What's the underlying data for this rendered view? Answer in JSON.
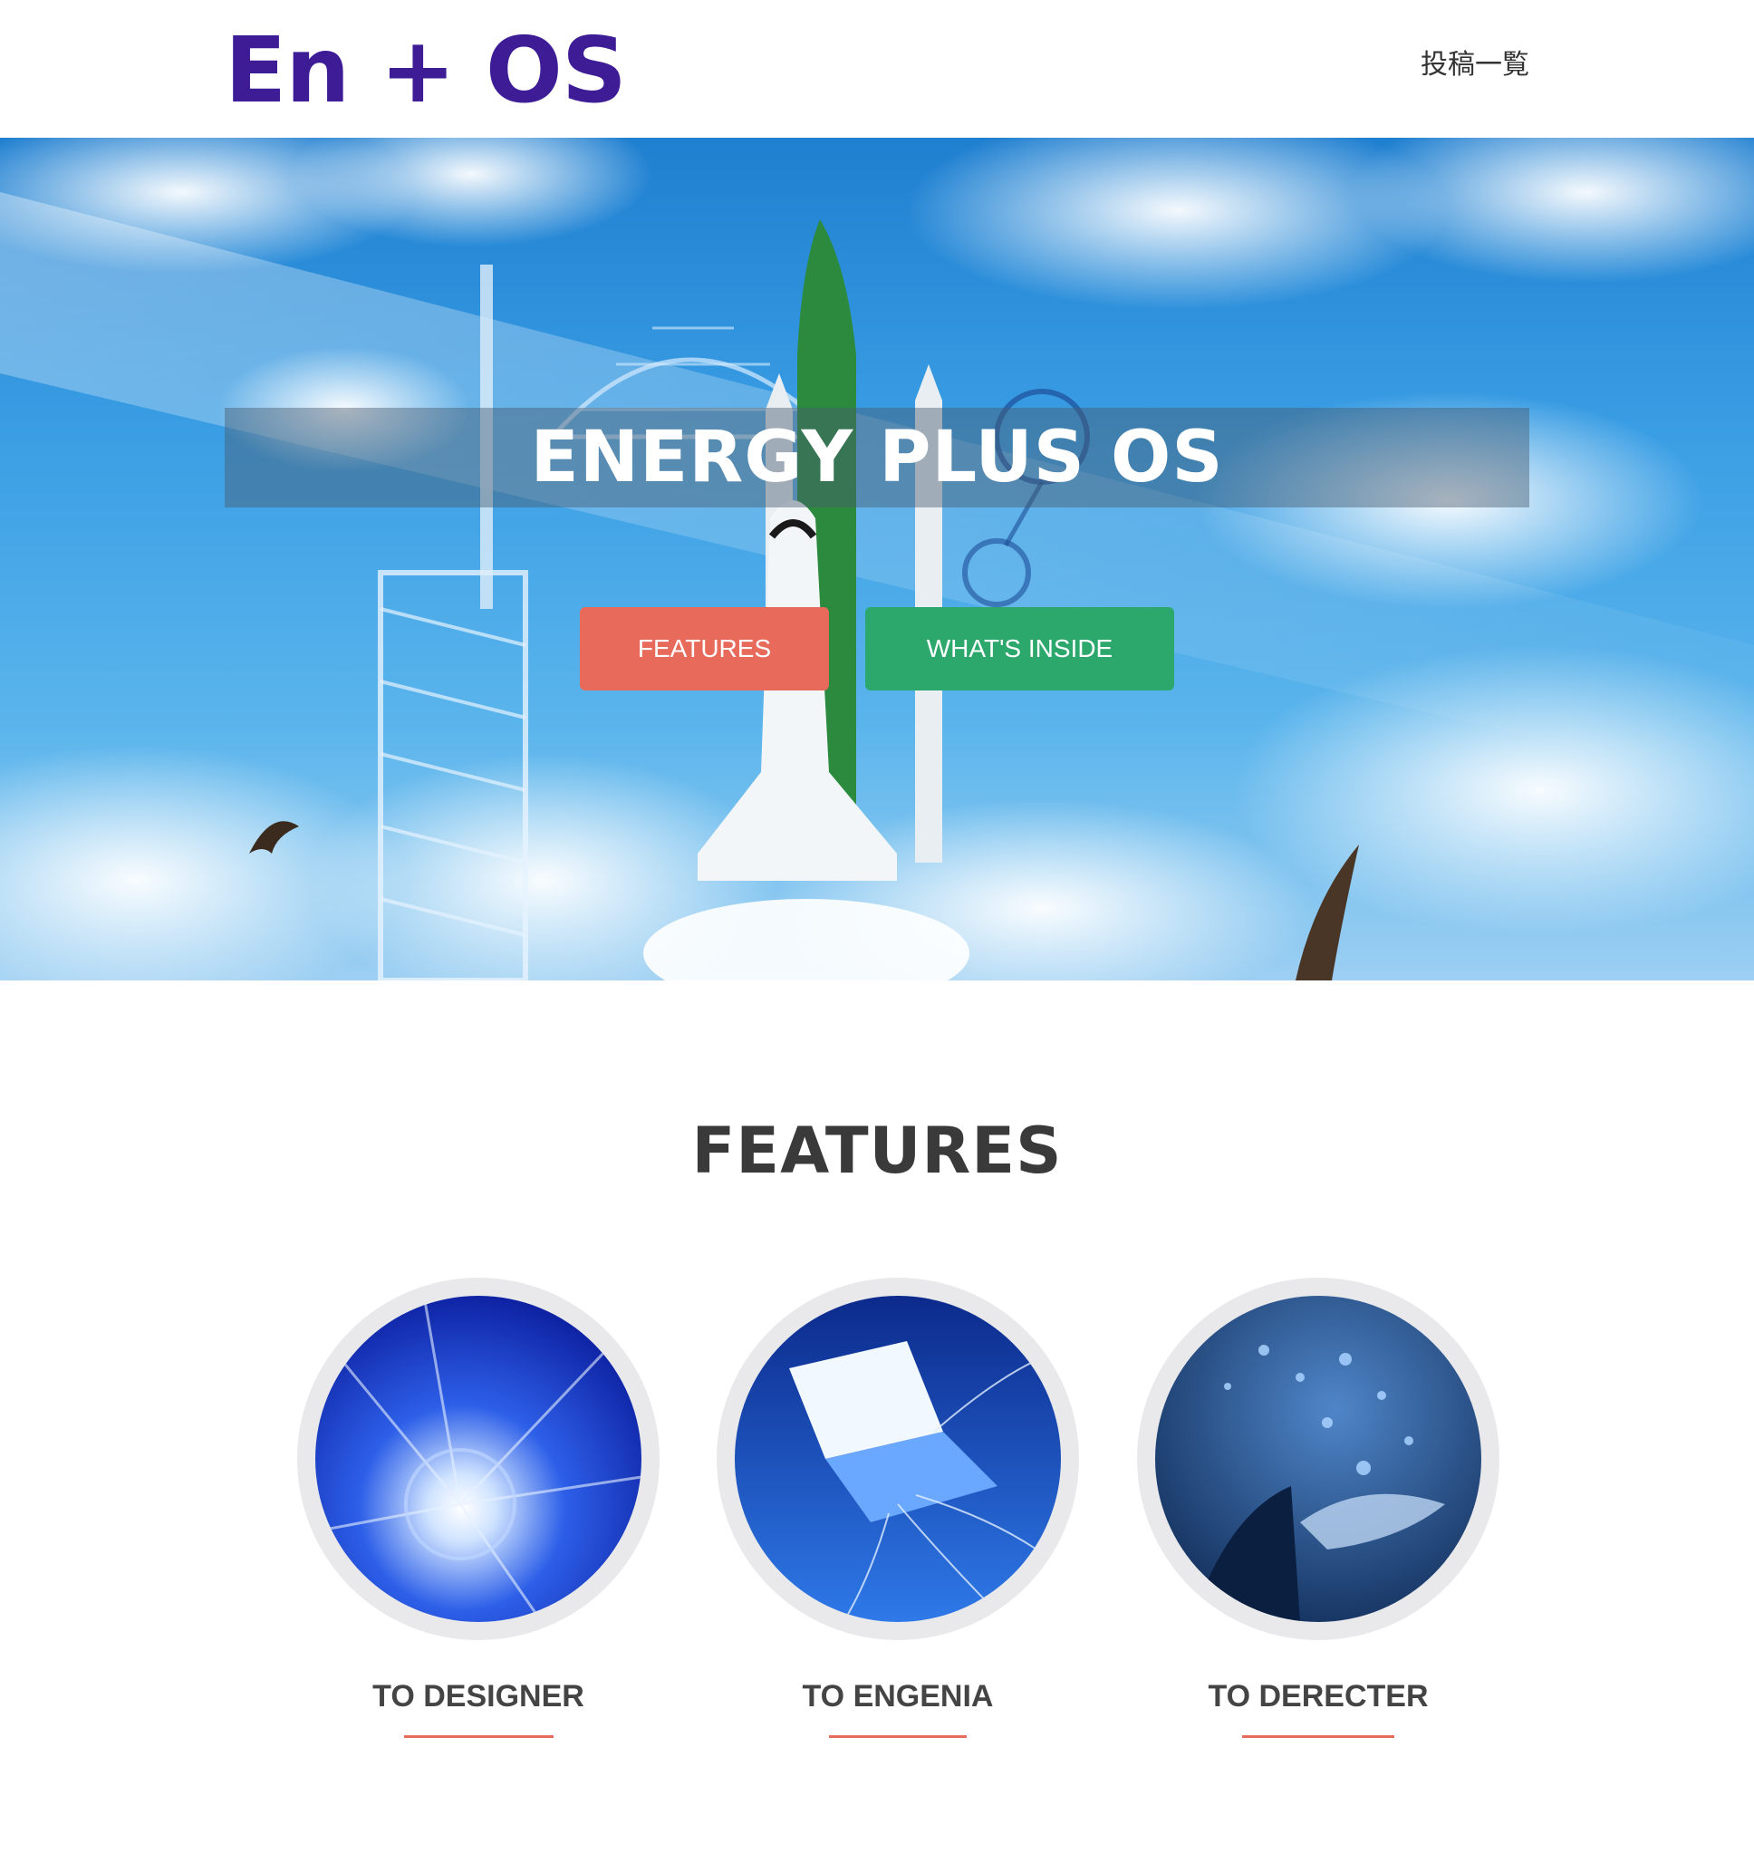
{
  "header": {
    "logo": "En + OS",
    "nav_post_list": "投稿一覧"
  },
  "hero": {
    "title": "ENERGY PLUS OS",
    "buttons": {
      "features": "FEATURES",
      "whats_inside": "WHAT'S INSIDE"
    }
  },
  "features_section": {
    "title": "FEATURES",
    "items": [
      {
        "label": "TO DESIGNER"
      },
      {
        "label": "TO ENGENIA"
      },
      {
        "label": "TO DERECTER"
      }
    ]
  },
  "colors": {
    "logo": "#3d1c96",
    "features_button": "#e76a5b",
    "whats_inside_button": "#2da86d",
    "underline": "#e76a5b"
  }
}
